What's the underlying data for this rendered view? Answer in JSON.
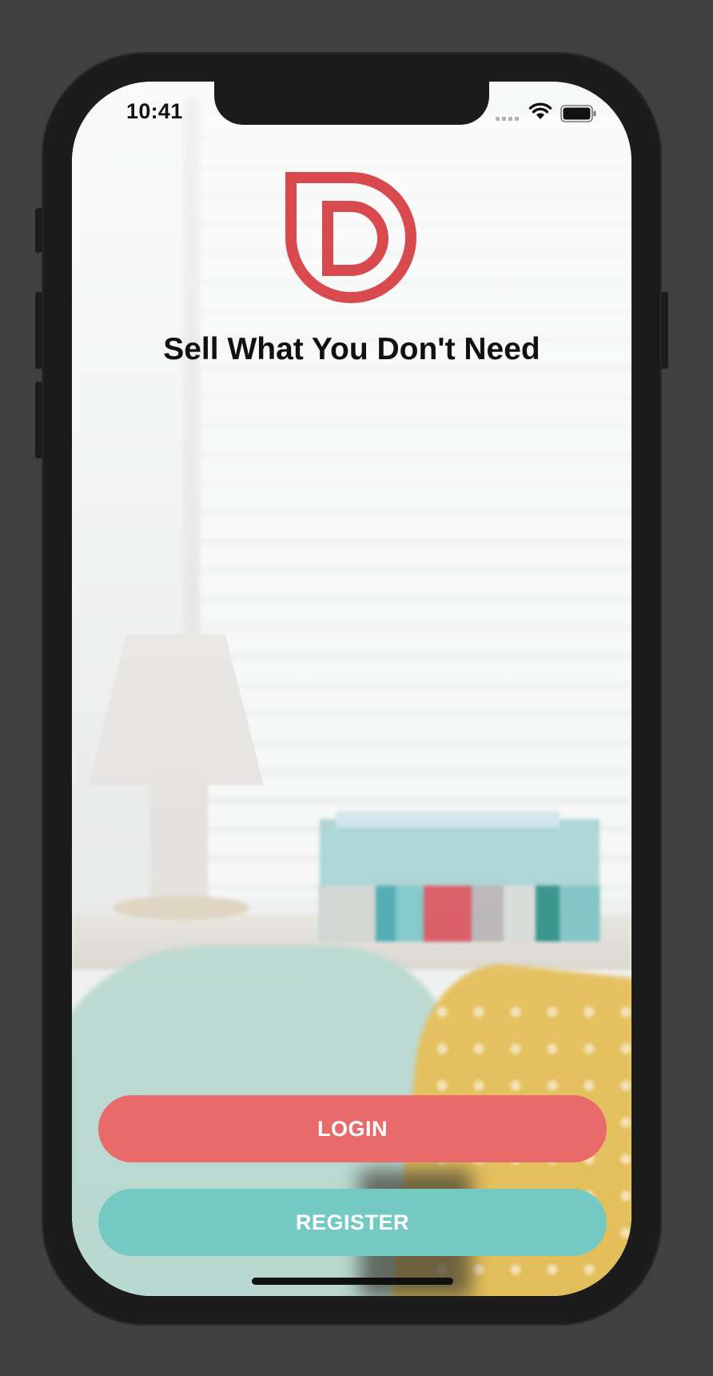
{
  "status_bar": {
    "time": "10:41",
    "icons": [
      "cellular-signal-icon",
      "wifi-icon",
      "battery-icon"
    ]
  },
  "app": {
    "logo_icon": "d-logo-icon",
    "brand_color": "#D94A4F",
    "tagline": "Sell What You Don't Need"
  },
  "actions": {
    "login_label": "LOGIN",
    "login_color": "#E96A6A",
    "register_label": "REGISTER",
    "register_color": "#74CAC2"
  }
}
